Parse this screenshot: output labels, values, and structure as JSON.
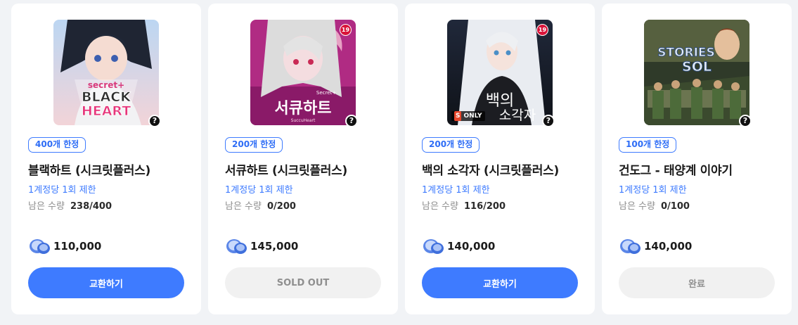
{
  "colors": {
    "accent": "#3e7bff",
    "disabled_bg": "#f1f1f1",
    "disabled_text": "#8f8f8f",
    "age_badge": "#d9143a"
  },
  "icons": {
    "price": "cash-coin-icon",
    "help": "question-mark-icon"
  },
  "products": [
    {
      "badge": "400개 한정",
      "title": "블랙하트 (시크릿플러스)",
      "per_account_limit": "1계정당 1회 제한",
      "remaining_label": "남은 수량",
      "remaining": "238/400",
      "price": "110,000",
      "action_label": "교환하기",
      "action_state": "available",
      "art_text": [
        "secret+",
        "BLACK",
        "HEART"
      ]
    },
    {
      "badge": "200개 한정",
      "title": "서큐하트 (시크릿플러스)",
      "per_account_limit": "1계정당 1회 제한",
      "remaining_label": "남은 수량",
      "remaining": "0/200",
      "price": "145,000",
      "action_label": "SOLD OUT",
      "action_state": "sold_out",
      "age_rating": "19",
      "art_text": [
        "서큐하트",
        "Secret+",
        "SuccuHeart"
      ]
    },
    {
      "badge": "200개 한정",
      "title": "백의 소각자 (시크릿플러스)",
      "per_account_limit": "1계정당 1회 제한",
      "remaining_label": "남은 수량",
      "remaining": "116/200",
      "price": "140,000",
      "action_label": "교환하기",
      "action_state": "available",
      "age_rating": "19",
      "only_badge": "ONLY",
      "only_badge_mark": "S",
      "art_text": [
        "백의",
        "소각자"
      ]
    },
    {
      "badge": "100개 한정",
      "title": "건도그 - 태양계 이야기",
      "per_account_limit": "1계정당 1회 제한",
      "remaining_label": "남은 수량",
      "remaining": "0/100",
      "price": "140,000",
      "action_label": "완료",
      "action_state": "completed",
      "art_text": [
        "STORIES",
        "SOL"
      ]
    }
  ]
}
